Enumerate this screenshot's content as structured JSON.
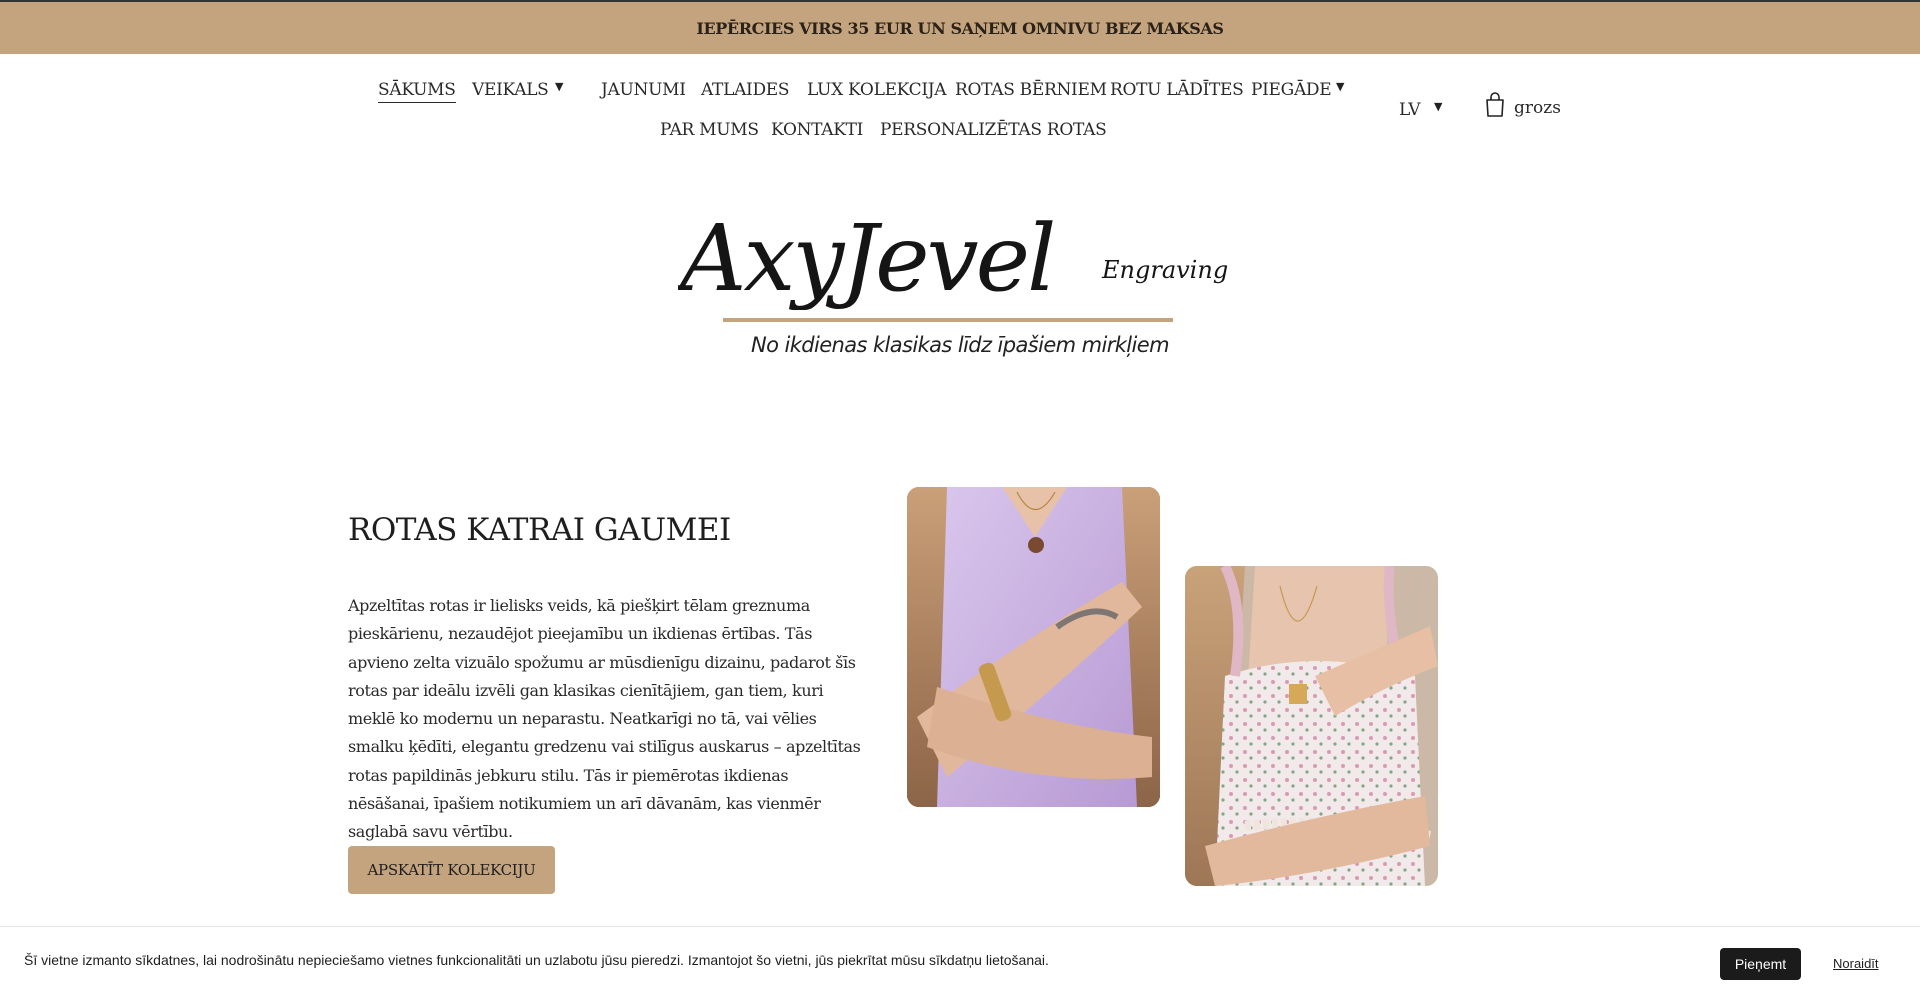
{
  "announcement": "IEPĒRCIES VIRS 35 EUR UN SAŅEM OMNIVU BEZ MAKSAS",
  "nav": {
    "items": [
      {
        "label": "SĀKUMS"
      },
      {
        "label": "VEIKALS"
      },
      {
        "label": "JAUNUMI"
      },
      {
        "label": "ATLAIDES"
      },
      {
        "label": "LUX KOLEKCIJA"
      },
      {
        "label": "ROTAS BĒRNIEM"
      },
      {
        "label": "ROTU LĀDĪTES"
      },
      {
        "label": "PIEGĀDE"
      },
      {
        "label": "PAR MUMS"
      },
      {
        "label": "KONTAKTI"
      },
      {
        "label": "PERSONALIZĒTAS ROTAS"
      }
    ],
    "language": "LV",
    "cart_label": "grozs"
  },
  "brand": {
    "logo_text": "AxyJevel",
    "logo_sub": "Engraving",
    "tagline": "No ikdienas klasikas līdz īpašiem mirkļiem",
    "accent_color": "#c4a47f"
  },
  "section": {
    "title": "ROTAS KATRAI GAUMEI",
    "body": "Apzeltītas rotas ir lielisks veids, kā piešķirt tēlam greznuma pieskārienu, nezaudējot pieejamību un ikdienas ērtības. Tās apvieno zelta vizuālo spožumu ar mūsdienīgu dizainu, padarot šīs rotas par ideālu izvēli gan klasikas cienītājiem, gan tiem, kuri meklē ko modernu un neparastu. Neatkarīgi no tā, vai vēlies smalku ķēdīti, elegantu gredzenu vai stilīgus auskarus – apzeltītas rotas papildinās jebkuru stilu. Tās ir piemērotas ikdienas nēsāšanai, īpašiem notikumiem un arī dāvanām, kas vienmēr saglabā savu vērtību.",
    "cta_label": "APSKATĪT KOLEKCIJU"
  },
  "cookie": {
    "text": "Šī vietne izmanto sīkdatnes, lai nodrošinātu nepieciešamo vietnes funkcionalitāti un uzlabotu jūsu pieredzi. Izmantojot šo vietni, jūs piekrītat mūsu sīkdatņu lietošanai.",
    "accept_label": "Pieņemt",
    "reject_label": "Noraidīt"
  }
}
